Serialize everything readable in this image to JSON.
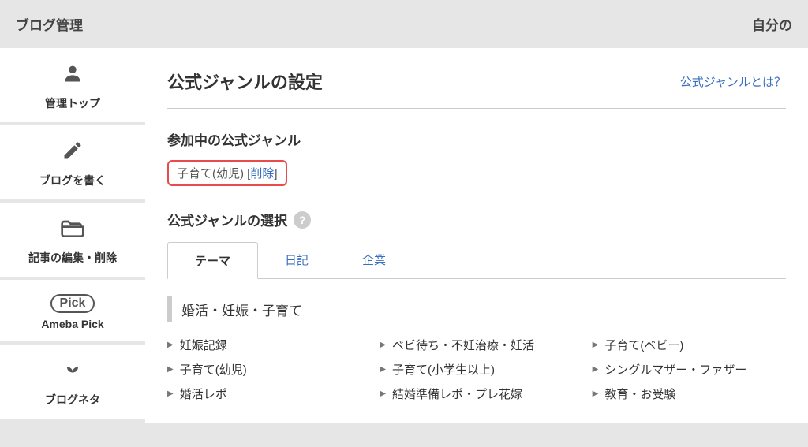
{
  "topbar": {
    "left": "ブログ管理",
    "right": "自分の"
  },
  "sidebar": {
    "items": [
      {
        "name": "sidebar-item-admin-top",
        "label": "管理トップ",
        "icon": "person"
      },
      {
        "name": "sidebar-item-write",
        "label": "ブログを書く",
        "icon": "pencil"
      },
      {
        "name": "sidebar-item-edit-delete",
        "label": "記事の編集・削除",
        "icon": "folder"
      },
      {
        "name": "sidebar-item-ameba-pick",
        "label": "Ameba Pick",
        "icon": "pick"
      },
      {
        "name": "sidebar-item-blog-neta",
        "label": "ブログネタ",
        "icon": "sprout"
      }
    ]
  },
  "page": {
    "title": "公式ジャンルの設定",
    "help_link": "公式ジャンルとは？"
  },
  "current_genre": {
    "section_title": "参加中の公式ジャンル",
    "name": "子育て(幼児)",
    "delete_label": "削除"
  },
  "genre_select": {
    "section_title": "公式ジャンルの選択",
    "tabs": [
      {
        "label": "テーマ",
        "active": true
      },
      {
        "label": "日記",
        "active": false
      },
      {
        "label": "企業",
        "active": false
      }
    ],
    "group_title": "婚活・妊娠・子育て",
    "items": [
      "妊娠記録",
      "ベビ待ち・不妊治療・妊活",
      "子育て(ベビー)",
      "子育て(幼児)",
      "子育て(小学生以上)",
      "シングルマザー・ファザー",
      "婚活レポ",
      "結婚準備レポ・プレ花嫁",
      "教育・お受験"
    ]
  }
}
